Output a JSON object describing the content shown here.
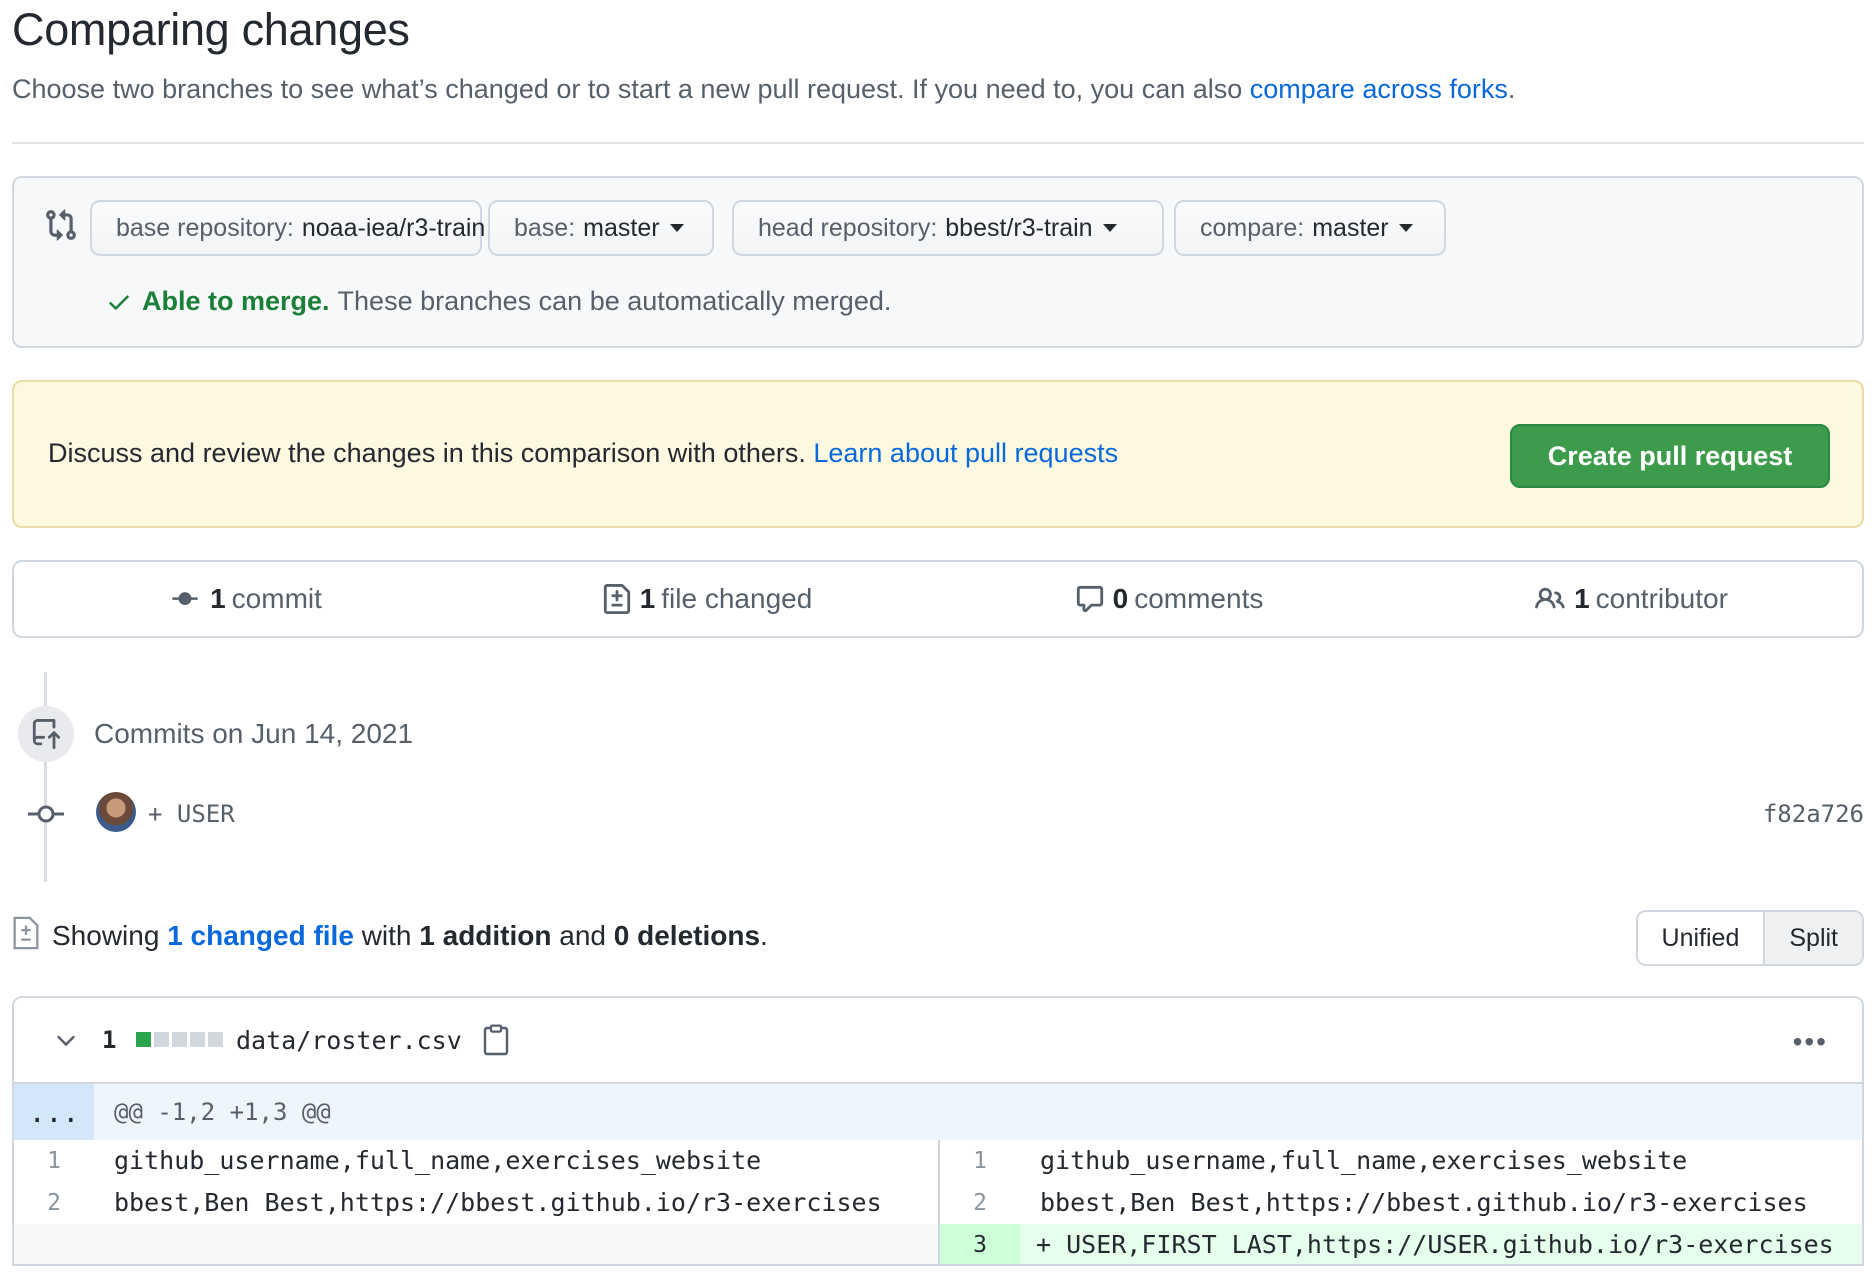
{
  "page": {
    "title": "Comparing changes",
    "subtitle_text": "Choose two branches to see what’s changed or to start a new pull request. If you need to, you can also",
    "subtitle_link": "compare across forks",
    "subtitle_end": "."
  },
  "range": {
    "base_repo_label": "base repository:",
    "base_repo_value": "noaa-iea/r3-train",
    "base_label": "base:",
    "base_value": "master",
    "head_repo_label": "head repository:",
    "head_repo_value": "bbest/r3-train",
    "compare_label": "compare:",
    "compare_value": "master",
    "merge_ok": "Able to merge.",
    "merge_text": "These branches can be automatically merged."
  },
  "flash": {
    "text": "Discuss and review the changes in this comparison with others.",
    "link": "Learn about pull requests",
    "button": "Create pull request"
  },
  "summary": {
    "commits_num": "1",
    "commits_label": "commit",
    "files_num": "1",
    "files_label": "file changed",
    "comments_num": "0",
    "comments_label": "comments",
    "contributors_num": "1",
    "contributors_label": "contributor"
  },
  "commits": {
    "date": "Commits on Jun 14, 2021",
    "message": "+ USER",
    "sha": "f82a726"
  },
  "toc": {
    "showing": "Showing",
    "changed_link": "1 changed file",
    "with": "with",
    "additions": "1 addition",
    "and": "and",
    "deletions": "0 deletions",
    "end": ".",
    "unified": "Unified",
    "split": "Split"
  },
  "file": {
    "diffstat": "1",
    "name": "data/roster.csv",
    "more": "•••",
    "hunk_expand": "...",
    "hunk_header": "@@ -1,2 +1,3 @@",
    "left": [
      {
        "ln": "1",
        "code": "github_username,full_name,exercises_website"
      },
      {
        "ln": "2",
        "code": "bbest,Ben Best,https://bbest.github.io/r3-exercises"
      }
    ],
    "right": [
      {
        "ln": "1",
        "code": "github_username,full_name,exercises_website"
      },
      {
        "ln": "2",
        "code": "bbest,Ben Best,https://bbest.github.io/r3-exercises"
      },
      {
        "ln": "3",
        "code": "+ USER,FIRST LAST,https://USER.github.io/r3-exercises"
      }
    ]
  },
  "colors": {
    "accent": "#0969da",
    "success": "#1a7f37",
    "create_button": "#3d9c4b",
    "flash_bg": "#fdf8e0",
    "added_bg": "#e6ffec"
  }
}
